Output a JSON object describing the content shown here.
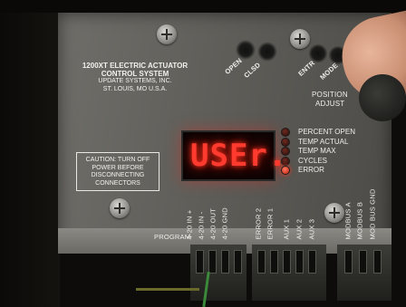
{
  "panel": {
    "title_lines": [
      "1200XT ELECTRIC ACTUATOR",
      "CONTROL SYSTEM"
    ],
    "company_lines": [
      "UPDATE SYSTEMS, INC.",
      "ST. LOUIS, MO  U.S.A."
    ],
    "caution_lines": [
      "CAUTION: TURN OFF",
      "POWER BEFORE",
      "DISCONNECTING",
      "CONNECTORS"
    ]
  },
  "buttons": {
    "open": "OPEN",
    "clsd": "CLSD",
    "entr": "ENTR",
    "mode": "MODE"
  },
  "position_adjust": [
    "POSITION",
    "ADJUST"
  ],
  "display": {
    "text": "USEr.",
    "color": "#ff3a2e"
  },
  "indicators": [
    {
      "label": "PERCENT OPEN",
      "on": false
    },
    {
      "label": "TEMP ACTUAL",
      "on": false
    },
    {
      "label": "TEMP MAX",
      "on": false
    },
    {
      "label": "CYCLES",
      "on": false
    },
    {
      "label": "ERROR",
      "on": true
    }
  ],
  "terminals": {
    "program": "PROGRAM",
    "labels": [
      "4-20 IN +",
      "4-20 IN -",
      "4-20 OUT",
      "4-20 GND",
      "ERROR 2",
      "ERROR 1",
      "AUX 1",
      "AUX 2",
      "AUX 3",
      "MODBUS A",
      "MODBUS B",
      "MOD BUS GND"
    ]
  }
}
